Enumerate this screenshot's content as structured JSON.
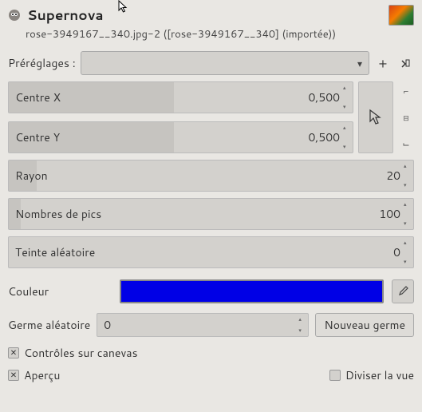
{
  "header": {
    "title": "Supernova",
    "subtitle": "rose-3949167__340.jpg-2 ([rose-3949167__340] (importée))"
  },
  "presets": {
    "label": "Préréglages :"
  },
  "centerX": {
    "label": "Centre X",
    "value": "0,500"
  },
  "centerY": {
    "label": "Centre Y",
    "value": "0,500"
  },
  "radius": {
    "label": "Rayon",
    "value": "20"
  },
  "spokes": {
    "label": "Nombres de pics",
    "value": "100"
  },
  "hue": {
    "label": "Teinte aléatoire",
    "value": "0"
  },
  "color": {
    "label": "Couleur"
  },
  "seed": {
    "label": "Germe aléatoire",
    "value": "0",
    "button": "Nouveau germe"
  },
  "canvas": {
    "label": "Contrôles sur canevas"
  },
  "preview": {
    "label": "Aperçu"
  },
  "split": {
    "label": "Diviser la vue"
  }
}
